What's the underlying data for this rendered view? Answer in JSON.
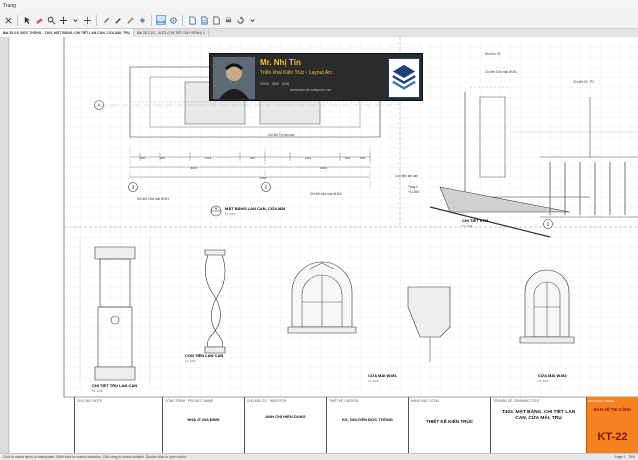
{
  "window": {
    "menu_label": "Trang"
  },
  "toolbar": {
    "tools": [
      "close-tool",
      "select-tool",
      "eraser-tool",
      "zoom-tool",
      "pan-tool",
      "line-tool",
      "text-tool",
      "dropper-tool",
      "paint-tool",
      "dimension-tool",
      "document-tool",
      "page-tool",
      "export-tool",
      "print-tool",
      "rotate-tool"
    ]
  },
  "tabs": [
    {
      "label": "Bài 25.3.6. ĐỨC THÔNG - T403. MẶT BẰNG, CHI TIẾT LAN CAN, CỬA MÁI, TRỤ",
      "active": true
    },
    {
      "label": "Bài 25.2.1/2 - XLỂ1 (CHI TIẾT DẦY SÊNH) 3",
      "active": false
    }
  ],
  "overlay": {
    "name": "Mr. Nhị Tín",
    "subtitle": "Triển khai Kiến Trúc - Layout Arc",
    "phone": "0906 . 886 . 890",
    "website": "www.kientruclayout.net"
  },
  "drawing": {
    "plan_title": "MẶT BẰNG LAN CAN, CỬA MÁI",
    "plan_scale": "TL: 1/50",
    "plan_tag_num": "A",
    "plan_tag_sheet": "-",
    "detail_stm": "CHI TIẾT STM",
    "detail_stm_scale": "TL: 1/20",
    "baluster_title": "CON TIỆN LAN CAN",
    "baluster_scale": "TL: 1/10",
    "pillar_title": "CHI TIẾT TRỤ LAN CAN",
    "pillar_scale": "TL: 1/10",
    "window1_title": "CỬA MÁI W.M1",
    "window1_scale": "TL: 1/20",
    "window2_title": "CỬA MÁI W.M2",
    "window2_scale": "TL: 1/20",
    "grid_labels": [
      "A",
      "3",
      "2",
      "1"
    ],
    "callouts": [
      "Chi tiết Cửa mái W.M1",
      "Chi tiết cửa mái W.M2",
      "Chi tiết Trụ lan can",
      "Chi tiết Cửa mái W.M1",
      "Chi tiết 03 - P3",
      "Con tiện lan can",
      "Kho thu 02"
    ],
    "plan_dims": [
      "300",
      "300",
      "1114",
      "320",
      "1114",
      "300",
      "300",
      "4040",
      "1250",
      "4040",
      "850",
      "850"
    ],
    "level_mark": "Tầng 2",
    "level_value": "+11.800"
  },
  "title_block": {
    "cells": [
      {
        "label": "GHI CHÚ / NOTE",
        "value": ""
      },
      {
        "label": "CÔNG TRÌNH - PROJECT NAME",
        "value": "NHÀ Ở GIA ĐÌNH"
      },
      {
        "label": "CHỦ ĐẦU TƯ - INVESTOR",
        "value": "ANH CHỊ HIỂN DUNG"
      },
      {
        "label": "THIẾT KẾ / DESIGN",
        "value": "KS. NGUYỄN ĐỨC THÔNG"
      },
      {
        "label": "HẠNG MỤC / ITEM",
        "value": "THIẾT KẾ KIẾN TRÚC"
      },
      {
        "label": "TÊN BẢN VẼ / DRAWING TITLE",
        "value": "T403. MẶT BẰNG, CHI TIẾT LAN CAN, CỬA MÁI, TRỤ"
      }
    ],
    "stage_label": "GIAI ĐOẠN / STAGE",
    "stage_value": "BẢN VẼ THI CÔNG",
    "sheet_no": "KT-22"
  },
  "status": {
    "hint": "Click to select items to manipulate. Shift+click to extend selection. Click drag to select multiple. Double-click to open editor.",
    "page": "Page 1",
    "zoom": "75%"
  },
  "colors": {
    "orange": "#f58220",
    "dark": "#2b2b2b",
    "yellow": "#f2c230",
    "grid": "#dde6ef"
  }
}
